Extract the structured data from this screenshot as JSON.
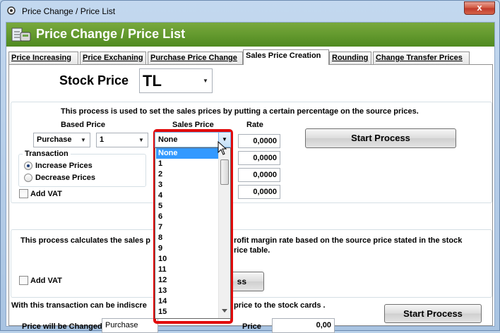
{
  "window": {
    "title": "Price Change / Price List",
    "close_label": "x"
  },
  "banner": {
    "title": "Price Change / Price List"
  },
  "tabs": [
    {
      "label": "Price Increasing",
      "active": false
    },
    {
      "label": "Price Exchaning",
      "active": false
    },
    {
      "label": "Purchase Price Change",
      "active": false
    },
    {
      "label": "Sales Price Creation",
      "active": true
    },
    {
      "label": "Rounding",
      "active": false
    },
    {
      "label": "Change Transfer Prices",
      "active": false
    }
  ],
  "stock_price": {
    "label": "Stock Price",
    "currency": "TL"
  },
  "section1": {
    "description": "This process is used to set the sales prices by putting a certain percentage on the source prices.",
    "based_price_label": "Based Price",
    "sales_price_label": "Sales Price",
    "rate_label": "Rate",
    "based_price_type": "Purchase",
    "based_price_no": "1",
    "rates": [
      "0,0000",
      "0,0000",
      "0,0000",
      "0,0000"
    ],
    "start_button": "Start Process",
    "transaction_label": "Transaction",
    "increase_label": "Increase Prices",
    "decrease_label": "Decrease Prices",
    "add_vat_label": "Add VAT"
  },
  "section2": {
    "description_left": "This process calculates the sales p",
    "description_right": "rofit margin rate based on the source price stated in the stock",
    "description_right2": "rice table.",
    "add_vat_label": "Add VAT",
    "button_partial": "ss"
  },
  "section3": {
    "description_left": "With this transaction can be indiscre",
    "description_right": "price to the stock cards .",
    "price_changed_label": "Price will be Changed",
    "price_type": "Purchase",
    "price_label": "Price",
    "price_value": "0,00",
    "start_button": "Start Process"
  },
  "dropdown": {
    "selected": "None",
    "options": [
      "None",
      "1",
      "2",
      "3",
      "4",
      "5",
      "6",
      "7",
      "8",
      "9",
      "10",
      "11",
      "12",
      "13",
      "14",
      "15"
    ]
  },
  "colors": {
    "highlight": "#e10b0b",
    "selection": "#3399ff",
    "banner": "#5e9a2b"
  }
}
